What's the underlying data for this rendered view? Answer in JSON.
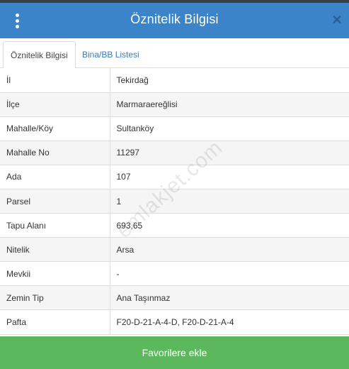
{
  "header": {
    "title": "Öznitelik Bilgisi",
    "close_glyph": "✕"
  },
  "tabs": [
    {
      "label": "Öznitelik Bilgisi",
      "active": true
    },
    {
      "label": "Bina/BB Listesi",
      "active": false
    }
  ],
  "attributes": [
    {
      "label": "İl",
      "value": "Tekirdağ"
    },
    {
      "label": "İlçe",
      "value": "Marmaraereğlisi"
    },
    {
      "label": "Mahalle/Köy",
      "value": "Sultanköy"
    },
    {
      "label": "Mahalle No",
      "value": "11297"
    },
    {
      "label": "Ada",
      "value": "107"
    },
    {
      "label": "Parsel",
      "value": "1"
    },
    {
      "label": "Tapu Alanı",
      "value": "693,65"
    },
    {
      "label": "Nitelik",
      "value": "Arsa"
    },
    {
      "label": "Mevkii",
      "value": "-"
    },
    {
      "label": "Zemin Tip",
      "value": "Ana Taşınmaz"
    },
    {
      "label": "Pafta",
      "value": "F20-D-21-A-4-D, F20-D-21-A-4"
    }
  ],
  "watermark": "emlakjet.com",
  "footer": {
    "button_label": "Favorilere ekle"
  },
  "icons": {
    "menu": "kebab-menu-icon",
    "close": "close-icon"
  },
  "colors": {
    "header_bg": "#3c84c9",
    "button_bg": "#5cb85c",
    "tab_link": "#3a7bbf"
  }
}
